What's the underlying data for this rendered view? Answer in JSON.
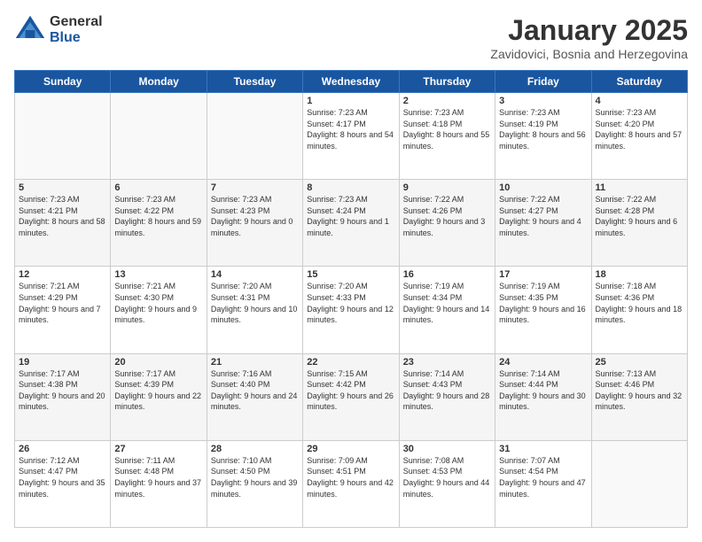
{
  "logo": {
    "general": "General",
    "blue": "Blue"
  },
  "title": {
    "month": "January 2025",
    "location": "Zavidovici, Bosnia and Herzegovina"
  },
  "weekdays": [
    "Sunday",
    "Monday",
    "Tuesday",
    "Wednesday",
    "Thursday",
    "Friday",
    "Saturday"
  ],
  "weeks": [
    [
      {
        "day": "",
        "sunrise": "",
        "sunset": "",
        "daylight": ""
      },
      {
        "day": "",
        "sunrise": "",
        "sunset": "",
        "daylight": ""
      },
      {
        "day": "",
        "sunrise": "",
        "sunset": "",
        "daylight": ""
      },
      {
        "day": "1",
        "sunrise": "Sunrise: 7:23 AM",
        "sunset": "Sunset: 4:17 PM",
        "daylight": "Daylight: 8 hours and 54 minutes."
      },
      {
        "day": "2",
        "sunrise": "Sunrise: 7:23 AM",
        "sunset": "Sunset: 4:18 PM",
        "daylight": "Daylight: 8 hours and 55 minutes."
      },
      {
        "day": "3",
        "sunrise": "Sunrise: 7:23 AM",
        "sunset": "Sunset: 4:19 PM",
        "daylight": "Daylight: 8 hours and 56 minutes."
      },
      {
        "day": "4",
        "sunrise": "Sunrise: 7:23 AM",
        "sunset": "Sunset: 4:20 PM",
        "daylight": "Daylight: 8 hours and 57 minutes."
      }
    ],
    [
      {
        "day": "5",
        "sunrise": "Sunrise: 7:23 AM",
        "sunset": "Sunset: 4:21 PM",
        "daylight": "Daylight: 8 hours and 58 minutes."
      },
      {
        "day": "6",
        "sunrise": "Sunrise: 7:23 AM",
        "sunset": "Sunset: 4:22 PM",
        "daylight": "Daylight: 8 hours and 59 minutes."
      },
      {
        "day": "7",
        "sunrise": "Sunrise: 7:23 AM",
        "sunset": "Sunset: 4:23 PM",
        "daylight": "Daylight: 9 hours and 0 minutes."
      },
      {
        "day": "8",
        "sunrise": "Sunrise: 7:23 AM",
        "sunset": "Sunset: 4:24 PM",
        "daylight": "Daylight: 9 hours and 1 minute."
      },
      {
        "day": "9",
        "sunrise": "Sunrise: 7:22 AM",
        "sunset": "Sunset: 4:26 PM",
        "daylight": "Daylight: 9 hours and 3 minutes."
      },
      {
        "day": "10",
        "sunrise": "Sunrise: 7:22 AM",
        "sunset": "Sunset: 4:27 PM",
        "daylight": "Daylight: 9 hours and 4 minutes."
      },
      {
        "day": "11",
        "sunrise": "Sunrise: 7:22 AM",
        "sunset": "Sunset: 4:28 PM",
        "daylight": "Daylight: 9 hours and 6 minutes."
      }
    ],
    [
      {
        "day": "12",
        "sunrise": "Sunrise: 7:21 AM",
        "sunset": "Sunset: 4:29 PM",
        "daylight": "Daylight: 9 hours and 7 minutes."
      },
      {
        "day": "13",
        "sunrise": "Sunrise: 7:21 AM",
        "sunset": "Sunset: 4:30 PM",
        "daylight": "Daylight: 9 hours and 9 minutes."
      },
      {
        "day": "14",
        "sunrise": "Sunrise: 7:20 AM",
        "sunset": "Sunset: 4:31 PM",
        "daylight": "Daylight: 9 hours and 10 minutes."
      },
      {
        "day": "15",
        "sunrise": "Sunrise: 7:20 AM",
        "sunset": "Sunset: 4:33 PM",
        "daylight": "Daylight: 9 hours and 12 minutes."
      },
      {
        "day": "16",
        "sunrise": "Sunrise: 7:19 AM",
        "sunset": "Sunset: 4:34 PM",
        "daylight": "Daylight: 9 hours and 14 minutes."
      },
      {
        "day": "17",
        "sunrise": "Sunrise: 7:19 AM",
        "sunset": "Sunset: 4:35 PM",
        "daylight": "Daylight: 9 hours and 16 minutes."
      },
      {
        "day": "18",
        "sunrise": "Sunrise: 7:18 AM",
        "sunset": "Sunset: 4:36 PM",
        "daylight": "Daylight: 9 hours and 18 minutes."
      }
    ],
    [
      {
        "day": "19",
        "sunrise": "Sunrise: 7:17 AM",
        "sunset": "Sunset: 4:38 PM",
        "daylight": "Daylight: 9 hours and 20 minutes."
      },
      {
        "day": "20",
        "sunrise": "Sunrise: 7:17 AM",
        "sunset": "Sunset: 4:39 PM",
        "daylight": "Daylight: 9 hours and 22 minutes."
      },
      {
        "day": "21",
        "sunrise": "Sunrise: 7:16 AM",
        "sunset": "Sunset: 4:40 PM",
        "daylight": "Daylight: 9 hours and 24 minutes."
      },
      {
        "day": "22",
        "sunrise": "Sunrise: 7:15 AM",
        "sunset": "Sunset: 4:42 PM",
        "daylight": "Daylight: 9 hours and 26 minutes."
      },
      {
        "day": "23",
        "sunrise": "Sunrise: 7:14 AM",
        "sunset": "Sunset: 4:43 PM",
        "daylight": "Daylight: 9 hours and 28 minutes."
      },
      {
        "day": "24",
        "sunrise": "Sunrise: 7:14 AM",
        "sunset": "Sunset: 4:44 PM",
        "daylight": "Daylight: 9 hours and 30 minutes."
      },
      {
        "day": "25",
        "sunrise": "Sunrise: 7:13 AM",
        "sunset": "Sunset: 4:46 PM",
        "daylight": "Daylight: 9 hours and 32 minutes."
      }
    ],
    [
      {
        "day": "26",
        "sunrise": "Sunrise: 7:12 AM",
        "sunset": "Sunset: 4:47 PM",
        "daylight": "Daylight: 9 hours and 35 minutes."
      },
      {
        "day": "27",
        "sunrise": "Sunrise: 7:11 AM",
        "sunset": "Sunset: 4:48 PM",
        "daylight": "Daylight: 9 hours and 37 minutes."
      },
      {
        "day": "28",
        "sunrise": "Sunrise: 7:10 AM",
        "sunset": "Sunset: 4:50 PM",
        "daylight": "Daylight: 9 hours and 39 minutes."
      },
      {
        "day": "29",
        "sunrise": "Sunrise: 7:09 AM",
        "sunset": "Sunset: 4:51 PM",
        "daylight": "Daylight: 9 hours and 42 minutes."
      },
      {
        "day": "30",
        "sunrise": "Sunrise: 7:08 AM",
        "sunset": "Sunset: 4:53 PM",
        "daylight": "Daylight: 9 hours and 44 minutes."
      },
      {
        "day": "31",
        "sunrise": "Sunrise: 7:07 AM",
        "sunset": "Sunset: 4:54 PM",
        "daylight": "Daylight: 9 hours and 47 minutes."
      },
      {
        "day": "",
        "sunrise": "",
        "sunset": "",
        "daylight": ""
      }
    ]
  ]
}
